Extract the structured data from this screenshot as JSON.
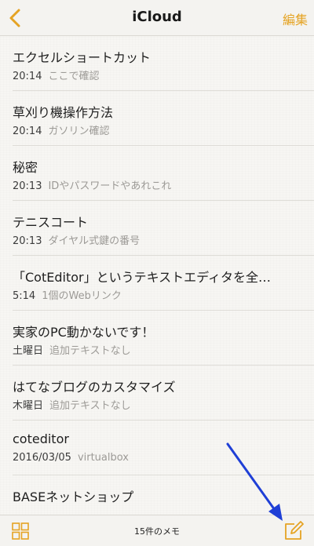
{
  "navbar": {
    "back_icon": "chevron-left-icon",
    "title": "iCloud",
    "edit_label": "編集"
  },
  "notes": [
    {
      "title": "エクセルショートカット",
      "time": "20:14",
      "preview": "ここで確認"
    },
    {
      "title": "草刈り機操作方法",
      "time": "20:14",
      "preview": "ガソリン確認"
    },
    {
      "title": "秘密",
      "time": "20:13",
      "preview": "IDやパスワードやあれこれ"
    },
    {
      "title": "テニスコート",
      "time": "20:13",
      "preview": "ダイヤル式鍵の番号"
    },
    {
      "title": "「CotEditor」というテキストエディタを全…",
      "time": "5:14",
      "preview": "1個のWebリンク"
    },
    {
      "title": "実家のPC動かないです！",
      "time": "土曜日",
      "preview": "追加テキストなし"
    },
    {
      "title": "はてなブログのカスタマイズ",
      "time": "木曜日",
      "preview": "追加テキストなし"
    },
    {
      "title": "coteditor",
      "time": "2016/03/05",
      "preview": "virtualbox"
    },
    {
      "title": "BASEネットショップ",
      "time": "",
      "preview": ""
    }
  ],
  "toolbar": {
    "grid_icon": "grid-icon",
    "count_label": "15件のメモ",
    "compose_icon": "compose-icon"
  },
  "colors": {
    "accent": "#e5a323",
    "annotation": "#1f3fd6"
  }
}
